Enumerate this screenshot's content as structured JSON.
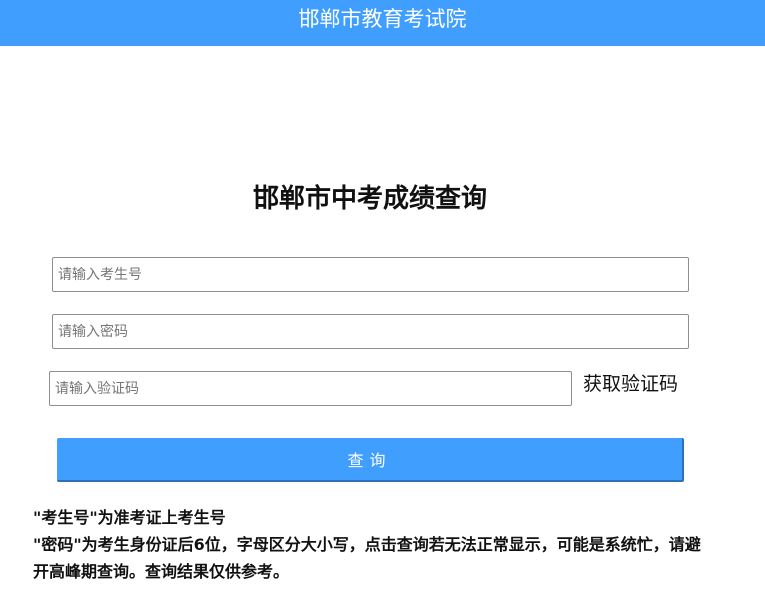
{
  "header": {
    "title": "邯郸市教育考试院"
  },
  "main": {
    "title": "邯郸市中考成绩查询",
    "form": {
      "candidate_id": {
        "value": "",
        "placeholder": "请输入考生号"
      },
      "password": {
        "value": "",
        "placeholder": "请输入密码"
      },
      "captcha": {
        "value": "",
        "placeholder": "请输入验证码"
      },
      "get_captcha_label": "获取验证码",
      "query_button_label": "查询"
    },
    "notes": [
      "\"考生号\"为准考证上考生号",
      "\"密码\"为考生身份证后6位，字母区分大小写，点击查询若无法正常显示，可能是系统忙，请避开高峰期查询。查询结果仅供参考。"
    ]
  },
  "colors": {
    "accent": "#409eff",
    "text": "#111111"
  }
}
